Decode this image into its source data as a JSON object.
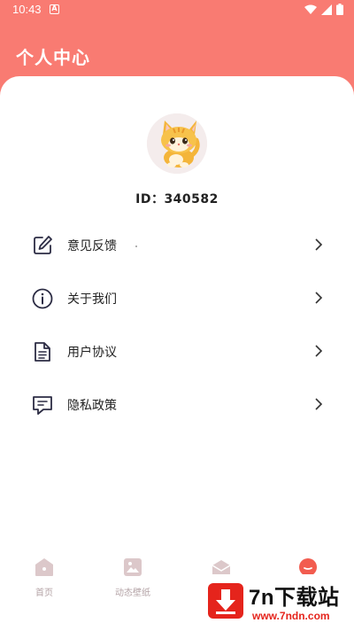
{
  "status_bar": {
    "time": "10:43",
    "notif_letter": "A"
  },
  "header": {
    "title": "个人中心"
  },
  "profile": {
    "id_text": "ID：340582"
  },
  "menu": [
    {
      "label": "意见反馈",
      "icon": "edit-icon"
    },
    {
      "label": "关于我们",
      "icon": "info-icon"
    },
    {
      "label": "用户协议",
      "icon": "document-icon"
    },
    {
      "label": "隐私政策",
      "icon": "message-icon"
    }
  ],
  "tabs": [
    {
      "label": "首页",
      "icon": "home-icon"
    },
    {
      "label": "动态壁纸",
      "icon": "image-icon"
    },
    {
      "label": "",
      "icon": "mail-icon"
    },
    {
      "label": "",
      "icon": "profile-icon"
    }
  ],
  "watermark": {
    "title": "7n下载站",
    "url": "www.7ndn.com"
  },
  "colors": {
    "primary": "#f97b72",
    "tab_inactive": "#d9c5c7",
    "watermark_red": "#e5241c"
  }
}
